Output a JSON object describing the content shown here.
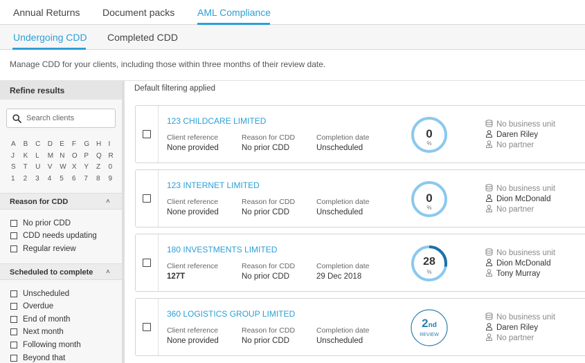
{
  "topnav": {
    "tabs": [
      {
        "label": "Annual Returns"
      },
      {
        "label": "Document packs"
      },
      {
        "label": "AML Compliance"
      }
    ]
  },
  "subnav": {
    "tabs": [
      {
        "label": "Undergoing CDD"
      },
      {
        "label": "Completed CDD"
      }
    ]
  },
  "description": "Manage CDD for your clients, including those within three months of their review date.",
  "sidebar": {
    "title": "Refine results",
    "search_placeholder": "Search clients",
    "alphabet": [
      [
        "A",
        "B",
        "C",
        "D",
        "E",
        "F",
        "G",
        "H",
        "I"
      ],
      [
        "J",
        "K",
        "L",
        "M",
        "N",
        "O",
        "P",
        "Q",
        "R"
      ],
      [
        "S",
        "T",
        "U",
        "V",
        "W",
        "X",
        "Y",
        "Z",
        "0"
      ],
      [
        "1",
        "2",
        "3",
        "4",
        "5",
        "6",
        "7",
        "8",
        "9"
      ]
    ],
    "reason_section": {
      "title": "Reason for CDD",
      "options": [
        "No prior CDD",
        "CDD needs updating",
        "Regular review"
      ]
    },
    "schedule_section": {
      "title": "Scheduled to complete",
      "options": [
        "Unscheduled",
        "Overdue",
        "End of month",
        "Next month",
        "Following month",
        "Beyond that"
      ]
    }
  },
  "filter_note": "Default filtering applied",
  "labels": {
    "client_reference": "Client reference",
    "reason_for_cdd": "Reason for CDD",
    "completion_date": "Completion date"
  },
  "clients": [
    {
      "name": "123 CHILDCARE LIMITED",
      "client_reference": "None provided",
      "reason": "No prior CDD",
      "completion_date": "Unscheduled",
      "progress": 0,
      "progress_label": "0",
      "progress_unit": "%",
      "business_unit": "No business unit",
      "manager": "Daren Riley",
      "partner": "No partner"
    },
    {
      "name": "123 INTERNET LIMITED",
      "client_reference": "None provided",
      "reason": "No prior CDD",
      "completion_date": "Unscheduled",
      "progress": 0,
      "progress_label": "0",
      "progress_unit": "%",
      "business_unit": "No business unit",
      "manager": "Dion McDonald",
      "partner": "No partner"
    },
    {
      "name": "180 INVESTMENTS LIMITED",
      "client_reference": "127T",
      "reason": "No prior CDD",
      "completion_date": "29 Dec 2018",
      "progress": 28,
      "progress_label": "28",
      "progress_unit": "%",
      "business_unit": "No business unit",
      "manager": "Dion McDonald",
      "partner": "Tony Murray"
    },
    {
      "name": "360 LOGISTICS GROUP LIMITED",
      "client_reference": "None provided",
      "reason": "No prior CDD",
      "completion_date": "Unscheduled",
      "review_number": "2",
      "review_suffix": "nd",
      "review_label": "REVIEW",
      "business_unit": "No business unit",
      "manager": "Daren Riley",
      "partner": "No partner"
    }
  ],
  "colors": {
    "accent": "#2a9fd8",
    "ring_track": "#8cc8ee",
    "ring_progress": "#1f6fa8",
    "review_ring": "#2a7fb0"
  }
}
